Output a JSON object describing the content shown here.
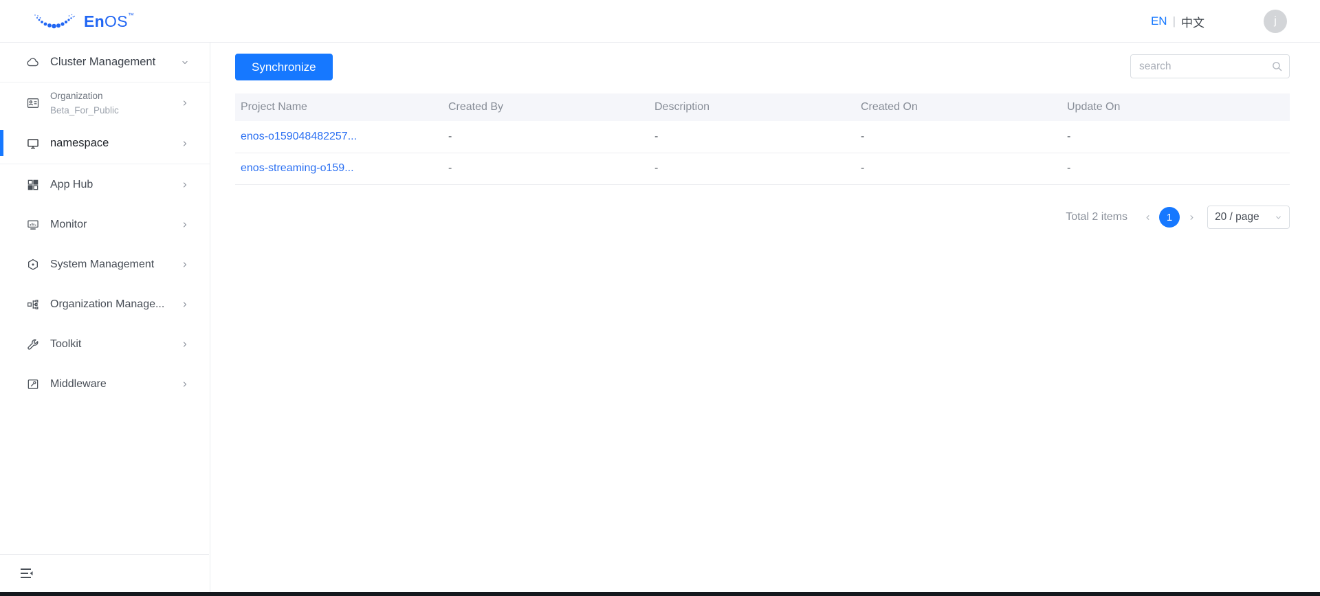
{
  "brand": {
    "logo_bold": "En",
    "logo_light": "OS",
    "trademark": "™"
  },
  "header": {
    "lang_en": "EN",
    "lang_separator": "|",
    "lang_zh": "中文",
    "avatar_initial": "j"
  },
  "sidebar": {
    "items": [
      {
        "label": "Cluster Management",
        "icon": "cloud-icon",
        "chevron": "down"
      },
      {
        "label": "Organization",
        "sublabel": "Beta_For_Public",
        "icon": "id-card-icon",
        "chevron": "right"
      },
      {
        "label": "namespace",
        "icon": "monitor-icon",
        "chevron": "right",
        "active": true
      },
      {
        "label": "App Hub",
        "icon": "appstore-icon",
        "chevron": "right"
      },
      {
        "label": "Monitor",
        "icon": "dashboard-monitor-icon",
        "chevron": "right"
      },
      {
        "label": "System Management",
        "icon": "hexagon-settings-icon",
        "chevron": "right"
      },
      {
        "label": "Organization Manage...",
        "icon": "org-chart-icon",
        "chevron": "right"
      },
      {
        "label": "Toolkit",
        "icon": "wrench-icon",
        "chevron": "right"
      },
      {
        "label": "Middleware",
        "icon": "middleware-icon",
        "chevron": "right"
      }
    ]
  },
  "toolbar": {
    "synchronize_label": "Synchronize",
    "search_placeholder": "search"
  },
  "table": {
    "columns": [
      "Project Name",
      "Created By",
      "Description",
      "Created On",
      "Update On"
    ],
    "rows": [
      {
        "project_name": "enos-o159048482257...",
        "created_by": "-",
        "description": "-",
        "created_on": "-",
        "update_on": "-"
      },
      {
        "project_name": "enos-streaming-o159...",
        "created_by": "-",
        "description": "-",
        "created_on": "-",
        "update_on": "-"
      }
    ]
  },
  "pagination": {
    "total_text": "Total 2 items",
    "current_page": "1",
    "page_size_label": "20 / page"
  },
  "colors": {
    "accent": "#1678ff",
    "link": "#2a6ff2",
    "logo_blue": "#2166f3",
    "bottom_strip": "#15181d"
  }
}
